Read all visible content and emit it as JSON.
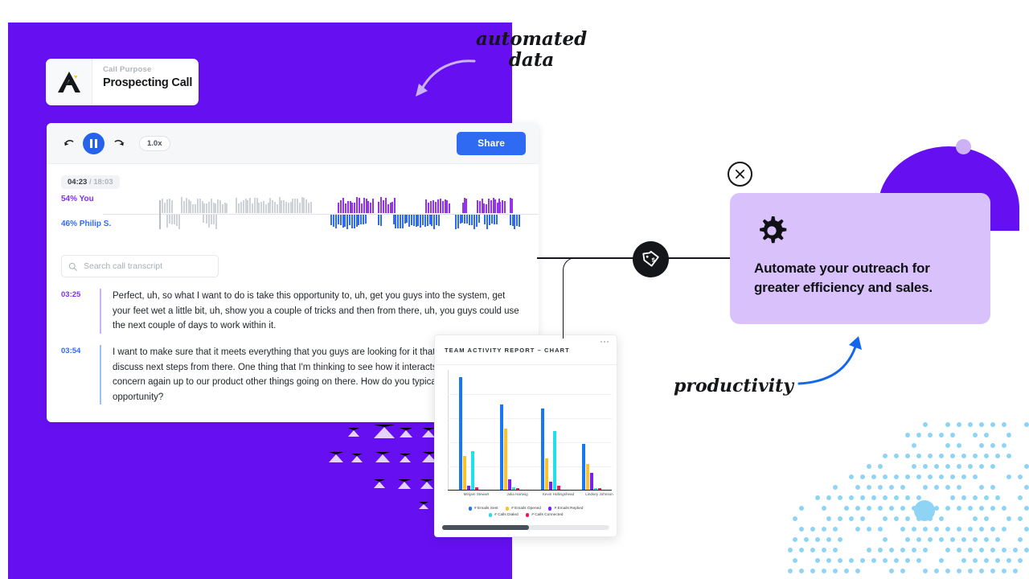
{
  "brand": {
    "logo_icon": "triangle-a-logo",
    "call_purpose_label": "Call Purpose",
    "call_purpose_value": "Prospecting Call"
  },
  "player": {
    "controls": {
      "rewind_icon": "rewind-arrow-icon",
      "play_pause_icon": "pause-icon",
      "forward_icon": "forward-arrow-icon",
      "speed_label": "1.0x"
    },
    "share_label": "Share",
    "timecode_current": "04:23",
    "timecode_total": "18:03",
    "speakers": [
      {
        "name": "You",
        "percent": "54%",
        "label": "54% You",
        "color": "#7b2ff7"
      },
      {
        "name": "Philip S.",
        "percent": "46%",
        "label": "46% Philip S.",
        "color": "#2f6bf2"
      }
    ],
    "search": {
      "icon": "search-icon",
      "placeholder": "Search call transcript",
      "value": ""
    },
    "transcript": [
      {
        "time": "03:25",
        "speaker": "You",
        "text": "Perfect, uh, so what I want to do is take this opportunity to, uh, get you guys into the system, get your feet wet a little bit, uh, show you a couple of tricks and then from there, uh, you guys could use the next couple of days to work within it."
      },
      {
        "time": "03:54",
        "speaker": "Philip S.",
        "text": "I want to make sure that it meets everything that you guys are looking for it that we can kind of discuss next steps from there. One thing that I'm thinking to see how it interacts with myself and my concern again up to our product other things going on there. How do you typically handle that opportunity?"
      }
    ]
  },
  "chart_card": {
    "title": "TEAM ACTIVITY REPORT – CHART",
    "menu_icon": "kebab-menu-icon",
    "scrollbar": "horizontal-scrollbar"
  },
  "chart_data": {
    "type": "bar",
    "title": "TEAM ACTIVITY REPORT – CHART",
    "categories": [
      "Mirijam Stewart",
      "Julia Hartwig",
      "Kevin Hollingshead",
      "Lindsey Johnson"
    ],
    "series": [
      {
        "name": "# Emails Sent",
        "color": "#1877f2",
        "values": [
          100,
          76,
          72,
          41
        ]
      },
      {
        "name": "# Emails Opened",
        "color": "#ffc224",
        "values": [
          30,
          54,
          28,
          23
        ]
      },
      {
        "name": "# Emails Replied",
        "color": "#7b1ff7",
        "values": [
          3,
          9,
          7,
          15
        ]
      },
      {
        "name": "# Calls Dialed",
        "color": "#22e0e8",
        "values": [
          34,
          2,
          52,
          1
        ]
      },
      {
        "name": "# Calls Connected",
        "color": "#f3175f",
        "values": [
          2,
          1,
          3,
          1
        ]
      }
    ],
    "ylim": [
      0,
      105
    ],
    "grid": true,
    "legend_position": "bottom",
    "xlabel": "",
    "ylabel": ""
  },
  "callout": {
    "gear_icon": "gear-icon",
    "text": "Automate your outreach for greater efficiency and sales.",
    "background_color": "#d9c2fb"
  },
  "nodes": {
    "tag_icon": "price-tag-dollar-icon",
    "close_icon": "close-x-icon"
  },
  "annotations": [
    {
      "name": "automated-data-note",
      "text": "automated\ndata",
      "arrow": "curved-arrow-down-left",
      "arrow_color": "#cbb2f7"
    },
    {
      "name": "productivity-note",
      "text": "productivity",
      "arrow": "curved-arrow-up-right",
      "arrow_color": "#1366ee"
    }
  ],
  "theme": {
    "brand_purple": "#6610f2",
    "accent_blue": "#2f6bf2",
    "lilac": "#d9c2fb",
    "sky": "#8fd4f5"
  }
}
